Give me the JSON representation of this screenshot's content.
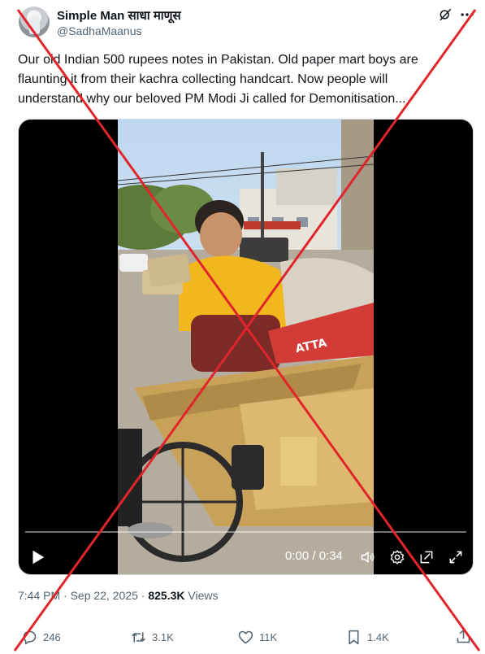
{
  "author": {
    "name": "Simple Man साधा माणूस",
    "handle": "@SadhaMaanus"
  },
  "tweet": {
    "lines": [
      "Our old Indian 500 rupees notes in Pakistan. Old paper mart boys are",
      "flaunting it from their kachra collecting handcart. Now people will",
      "understand why our beloved PM Modi Ji called for Demonitisation..."
    ]
  },
  "video": {
    "time": "0:00 / 0:34",
    "progress": 0,
    "sign_text": "ATTA"
  },
  "meta": {
    "time": "7:44 PM",
    "date": "Sep 22, 2025",
    "views_count": "825.3K",
    "views_label": "Views"
  },
  "actions": {
    "replies": "246",
    "reposts": "3.1K",
    "likes": "11K",
    "bookmarks": "1.4K"
  },
  "icons": [
    "grok-icon",
    "more-icon",
    "play-icon",
    "volume-icon",
    "settings-icon",
    "pip-icon",
    "fullscreen-icon",
    "reply-icon",
    "repost-icon",
    "like-icon",
    "bookmark-icon",
    "share-icon"
  ],
  "colors": {
    "cross": "#e0262b",
    "text_secondary": "#536471"
  }
}
